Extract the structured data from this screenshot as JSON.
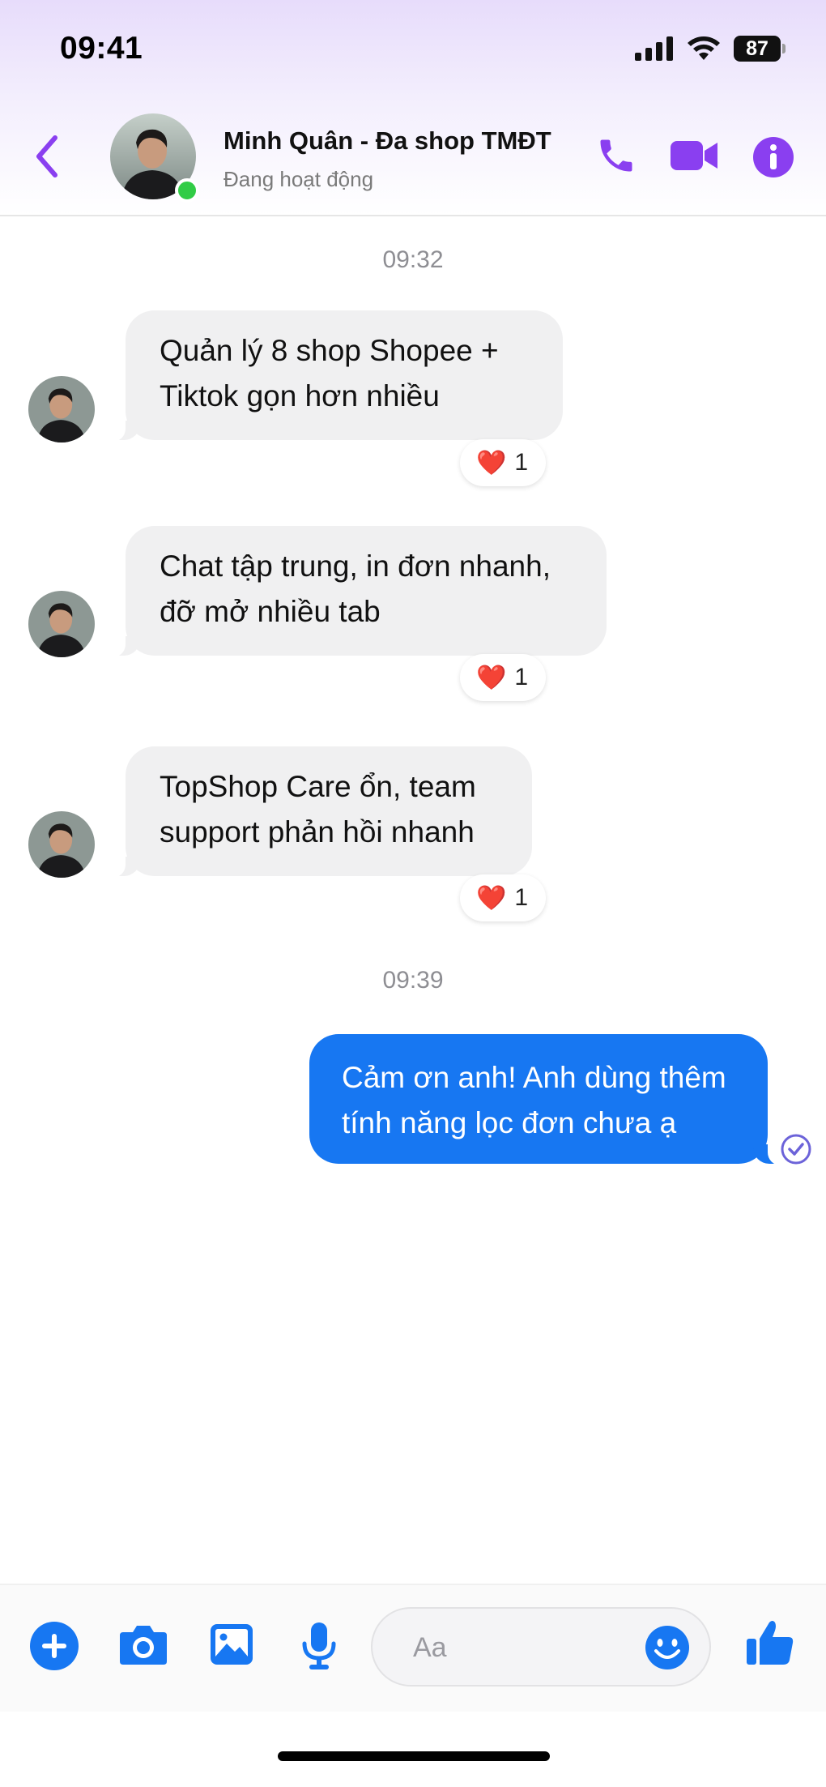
{
  "status_bar": {
    "time": "09:41",
    "battery": "87"
  },
  "header": {
    "contact_name": "Minh Quân - Đa shop TMĐT",
    "contact_status": "Đang hoạt động",
    "online": true
  },
  "conversation": {
    "timestamps": [
      "09:32",
      "09:39"
    ],
    "incoming": [
      {
        "lines": [
          "Quản lý 8 shop Shopee +",
          "Tiktok gọn hơn nhiều"
        ],
        "reaction": {
          "emoji": "❤️",
          "count": "1"
        }
      },
      {
        "lines": [
          "Chat tập trung, in đơn nhanh,",
          "đỡ mở nhiều tab"
        ],
        "reaction": {
          "emoji": "❤️",
          "count": "1"
        }
      },
      {
        "lines": [
          "TopShop Care ổn, team",
          "support phản hồi nhanh"
        ],
        "reaction": {
          "emoji": "❤️",
          "count": "1"
        }
      }
    ],
    "outgoing": [
      {
        "lines": [
          "Cảm ơn anh! Anh dùng thêm",
          "tính năng lọc đơn chưa ạ"
        ],
        "status": "sent"
      }
    ]
  },
  "composer": {
    "placeholder": "Aa"
  },
  "icons": {
    "back": "chevron-left-icon",
    "call": "phone-icon",
    "video": "video-camera-icon",
    "info": "info-icon",
    "plus": "plus-circle-icon",
    "camera": "camera-icon",
    "gallery": "image-icon",
    "mic": "microphone-icon",
    "emoji": "smiley-icon",
    "like": "thumbs-up-icon",
    "seen": "check-circle-icon"
  },
  "colors": {
    "accent_purple": "#8a3ff0",
    "messenger_blue": "#1777f2",
    "online_green": "#31cc46"
  }
}
